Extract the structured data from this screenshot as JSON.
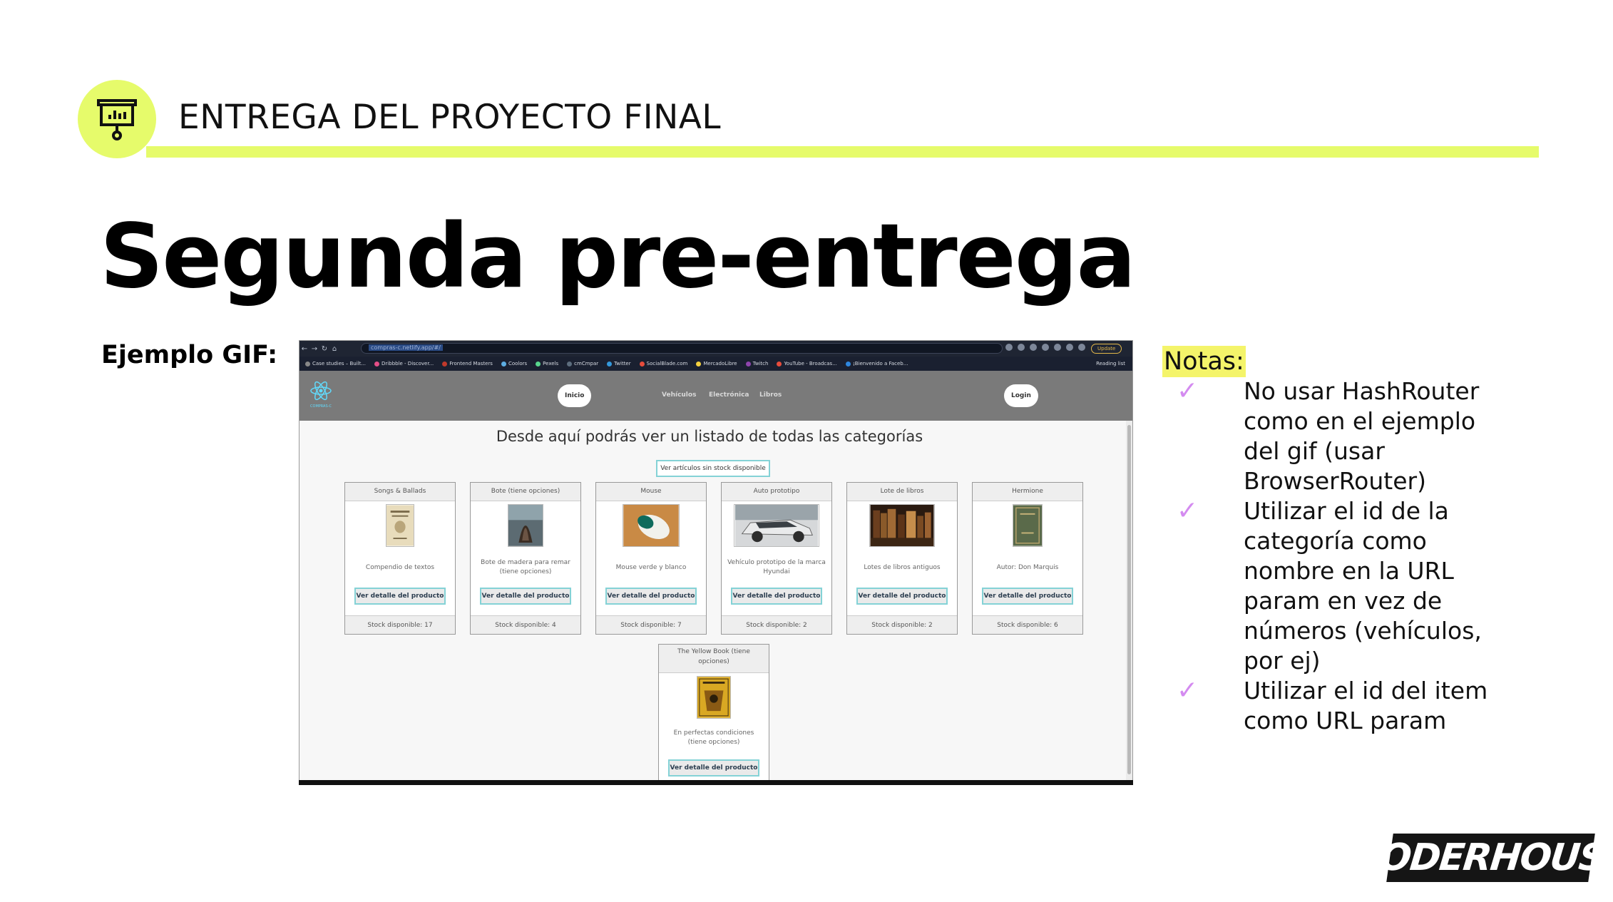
{
  "slide": {
    "header_title": "ENTREGA DEL PROYECTO FINAL",
    "main_title": "Segunda pre-entrega",
    "example_label": "Ejemplo GIF:",
    "header_icon": "presentation-board-icon",
    "accent_color": "#e6fb6b"
  },
  "notes": {
    "label": "Notas:",
    "check_icon": "checkmark-icon",
    "check_color": "#d48bf0",
    "items": [
      {
        "line1": "No usar HashRouter",
        "line2": "como en el ejemplo",
        "line3": "del gif (usar",
        "line4": "BrowserRouter)"
      },
      {
        "line1": "Utilizar el id de la",
        "line2": "categoría como",
        "line3": "nombre en la URL",
        "line4": "param en vez de",
        "line5": "números (vehículos,",
        "line6": "por ej)"
      },
      {
        "line1": "Utilizar el id del item",
        "line2": "como URL param"
      }
    ]
  },
  "browser": {
    "address": "compras-c.netlify.app/#/",
    "update_label": "Update",
    "reading_list": "Reading list",
    "bookmarks": [
      "Case studies – Built...",
      "Dribbble - Discover...",
      "Frontend Masters",
      "Coolors",
      "Pexels",
      "cmCmpar",
      "Twitter",
      "SocialBlade.com",
      "MercadoLibre",
      "Twitch",
      "YouTube - Broadcas...",
      "¡Bienvenido a Faceb..."
    ]
  },
  "app": {
    "logo_text": "COMPRAS-C",
    "nav": {
      "inicio": "Inicio",
      "vehiculos": "Vehículos",
      "electronica": "Electrónica",
      "libros": "Libros",
      "login": "Login"
    },
    "heading": "Desde aquí podrás ver un listado de todas las categorías",
    "no_stock_button": "Ver artículos sin stock disponible",
    "detail_button": "Ver detalle del producto",
    "cards": [
      {
        "title": "Songs & Ballads",
        "desc": "Compendio de textos",
        "stock": "Stock disponible: 17"
      },
      {
        "title": "Bote (tiene opciones)",
        "desc": "Bote de madera para remar (tiene opciones)",
        "stock": "Stock disponible: 4"
      },
      {
        "title": "Mouse",
        "desc": "Mouse verde y blanco",
        "stock": "Stock disponible: 7"
      },
      {
        "title": "Auto prototipo",
        "desc": "Vehículo prototipo de la marca Hyundai",
        "stock": "Stock disponible: 2"
      },
      {
        "title": "Lote de libros",
        "desc": "Lotes de libros antiguos",
        "stock": "Stock disponible: 2"
      },
      {
        "title": "Hermione",
        "desc": "Autor: Don Marquis",
        "stock": "Stock disponible: 6"
      },
      {
        "title": "The Yellow Book (tiene opciones)",
        "desc": "En perfectas condiciones (tiene opciones)",
        "stock": ""
      }
    ]
  },
  "brand": {
    "name": "CODERHOUSE"
  }
}
